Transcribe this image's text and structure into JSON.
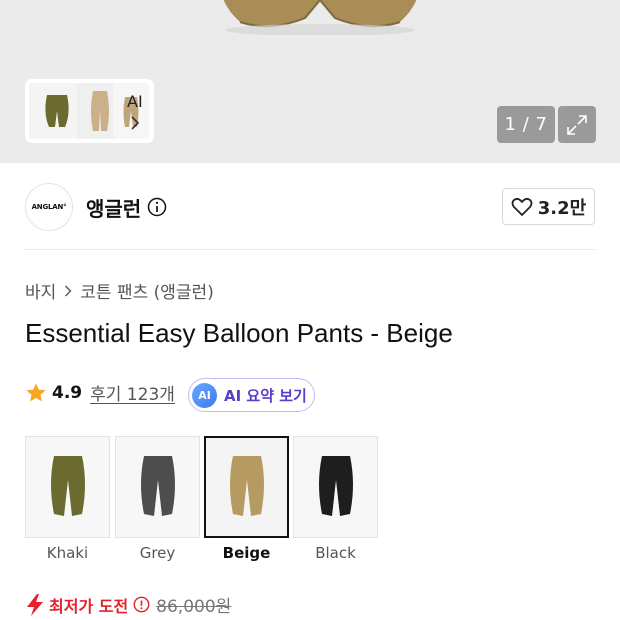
{
  "gallery": {
    "counter": "1 / 7",
    "thumb_label": "AI"
  },
  "brand": {
    "logo_text": "ANGLAN°",
    "name": "앵글런",
    "likes": "3.2만"
  },
  "breadcrumb": {
    "category": "바지",
    "subcategory": "코튼 팬츠 (앵글런)"
  },
  "product": {
    "title": "Essential Easy Balloon Pants - Beige"
  },
  "rating": {
    "score": "4.9",
    "reviews": "후기 123개",
    "ai_badge": "AI",
    "ai_summary_label": "AI 요약 보기"
  },
  "options": [
    {
      "label": "Khaki",
      "color": "#6b6a2f",
      "selected": false
    },
    {
      "label": "Grey",
      "color": "#4d4d4d",
      "selected": false
    },
    {
      "label": "Beige",
      "color": "#b59a62",
      "selected": true
    },
    {
      "label": "Black",
      "color": "#1e1e1e",
      "selected": false
    }
  ],
  "price": {
    "lowest_label": "최저가 도전",
    "original": "86,000원"
  },
  "colors": {
    "accent_red": "#e5202e",
    "ai_purple": "#5b3ec8",
    "star": "#f5a623"
  },
  "icons": {
    "brand_info": "info-icon",
    "like": "heart-icon",
    "expand": "expand-icon",
    "star": "star-icon",
    "bolt": "bolt-icon"
  }
}
